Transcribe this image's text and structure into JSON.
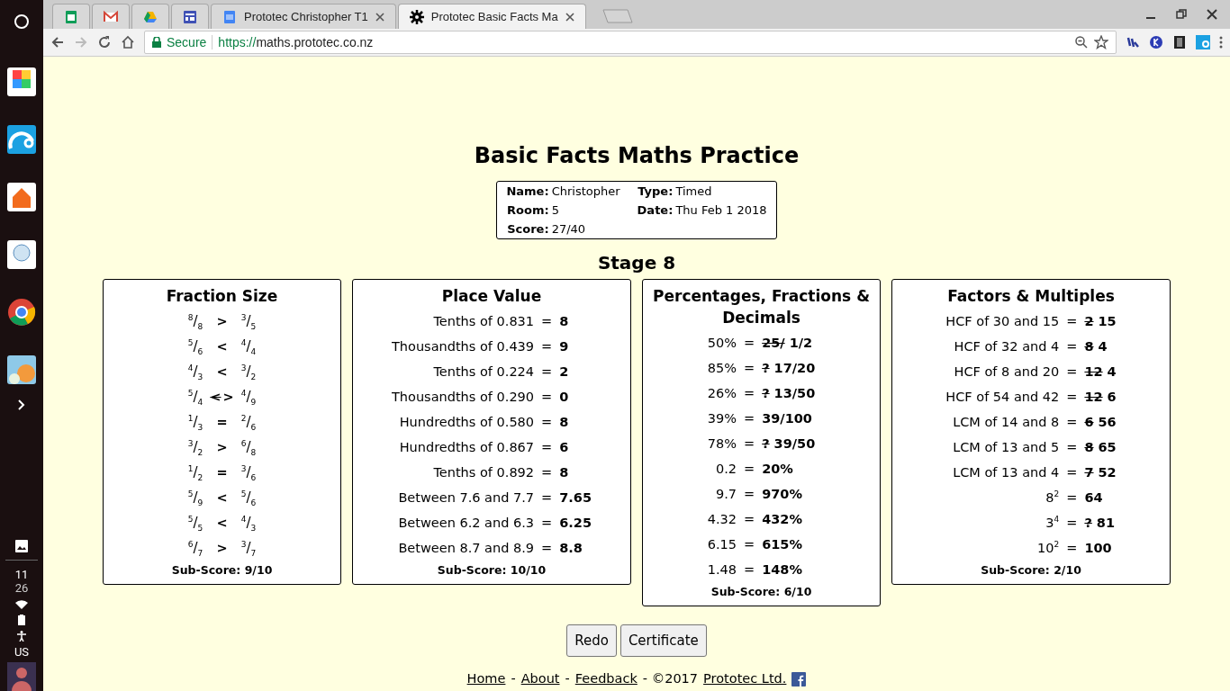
{
  "shelf": {
    "apps": [
      {
        "kind": "fotor"
      },
      {
        "kind": "wave"
      },
      {
        "kind": "go"
      },
      {
        "kind": "prezi"
      },
      {
        "kind": "chrome"
      },
      {
        "kind": "game"
      }
    ],
    "clock_hour": "11",
    "clock_minute": "26",
    "keyboard": "US"
  },
  "browser": {
    "tabs": [
      {
        "selected": false
      },
      {
        "selected": false
      },
      {
        "selected": false
      },
      {
        "selected": false
      },
      {
        "title": "Prototec Christopher T1",
        "selected": false
      },
      {
        "title": "Prototec Basic Facts Ma",
        "selected": true
      }
    ],
    "secure_label": "Secure",
    "url_scheme": "https://",
    "url_host": "maths.prototec.co.nz"
  },
  "page": {
    "title": "Basic Facts Maths Practice",
    "info": [
      {
        "label": "Name:",
        "value": "Christopher"
      },
      {
        "label": "Type:",
        "value": "Timed"
      },
      {
        "label": "Room:",
        "value": "5"
      },
      {
        "label": "Date:",
        "value": "Thu Feb 1 2018"
      },
      {
        "label": "Score:",
        "value": "27/40"
      }
    ],
    "stage": "Stage 8",
    "sections": [
      {
        "kind": "fractions",
        "title": "Fraction Size",
        "rows": [
          {
            "left": "$^{8}$/$_{8}$",
            "symbol": ">",
            "right": "$^{3}$/$_{5}$"
          },
          {
            "left": "$^{5}$/$_{6}$",
            "symbol": "<",
            "right": "$^{4}$/$_{4}$"
          },
          {
            "left": "$^{4}$/$_{3}$",
            "symbol": "<",
            "right": "$^{3}$/$_{2}$"
          },
          {
            "left": "$^{5}$/$_{4}$",
            "wrong": "<",
            "symbol": ">",
            "right": "$^{4}$/$_{9}$"
          },
          {
            "left": "$^{1}$/$_{3}$",
            "symbol": "=",
            "right": "$^{2}$/$_{6}$"
          },
          {
            "left": "$^{3}$/$_{2}$",
            "symbol": ">",
            "right": "$^{6}$/$_{8}$"
          },
          {
            "left": "$^{1}$/$_{2}$",
            "symbol": "=",
            "right": "$^{3}$/$_{6}$"
          },
          {
            "left": "$^{5}$/$_{9}$",
            "symbol": "<",
            "right": "$^{5}$/$_{6}$"
          },
          {
            "left": "$^{5}$/$_{5}$",
            "symbol": "<",
            "right": "$^{4}$/$_{3}$"
          },
          {
            "left": "$^{6}$/$_{7}$",
            "symbol": ">",
            "right": "$^{3}$/$_{7}$"
          }
        ],
        "subscore": "Sub-Score: 9/10"
      },
      {
        "kind": "equations",
        "title": "Place Value",
        "rows": [
          {
            "question": "Tenths of 0.831",
            "equals": "=",
            "answer": "8"
          },
          {
            "question": "Thousandths of 0.439",
            "equals": "=",
            "answer": "9"
          },
          {
            "question": "Tenths of 0.224",
            "equals": "=",
            "answer": "2"
          },
          {
            "question": "Thousandths of 0.290",
            "equals": "=",
            "answer": "0"
          },
          {
            "question": "Hundredths of 0.580",
            "equals": "=",
            "answer": "8"
          },
          {
            "question": "Hundredths of 0.867",
            "equals": "=",
            "answer": "6"
          },
          {
            "question": "Tenths of 0.892",
            "equals": "=",
            "answer": "8"
          },
          {
            "question": "Between 7.6 and 7.7",
            "equals": "=",
            "answer": "7.65"
          },
          {
            "question": "Between 6.2 and 6.3",
            "equals": "=",
            "answer": "6.25"
          },
          {
            "question": "Between 8.7 and 8.9",
            "equals": "=",
            "answer": "8.8"
          }
        ],
        "subscore": "Sub-Score: 10/10"
      },
      {
        "kind": "equations",
        "title": "Percentages, Fractions & Decimals",
        "rows": [
          {
            "question": "50%",
            "equals": "=",
            "wrong": "25/",
            "answer": "1/2"
          },
          {
            "question": "85%",
            "equals": "=",
            "wrong": "?",
            "answer": "17/20"
          },
          {
            "question": "26%",
            "equals": "=",
            "wrong": "?",
            "answer": "13/50"
          },
          {
            "question": "39%",
            "equals": "=",
            "answer": "39/100"
          },
          {
            "question": "78%",
            "equals": "=",
            "wrong": "?",
            "answer": "39/50"
          },
          {
            "question": "0.2",
            "equals": "=",
            "answer": "20%"
          },
          {
            "question": "9.7",
            "equals": "=",
            "answer": "970%"
          },
          {
            "question": "4.32",
            "equals": "=",
            "answer": "432%"
          },
          {
            "question": "6.15",
            "equals": "=",
            "answer": "615%"
          },
          {
            "question": "1.48",
            "equals": "=",
            "answer": "148%"
          }
        ],
        "subscore": "Sub-Score: 6/10"
      },
      {
        "kind": "equations",
        "title": "Factors & Multiples",
        "rows": [
          {
            "question": "HCF of 30 and 15",
            "equals": "=",
            "wrong": "2",
            "answer": "15"
          },
          {
            "question": "HCF of 32 and 4",
            "equals": "=",
            "wrong": "8",
            "answer": "4"
          },
          {
            "question": "HCF of 8 and 20",
            "equals": "=",
            "wrong": "12",
            "answer": "4"
          },
          {
            "question": "HCF of 54 and 42",
            "equals": "=",
            "wrong": "12",
            "answer": "6"
          },
          {
            "question": "LCM of 14 and 8",
            "equals": "=",
            "wrong": "6",
            "answer": "56"
          },
          {
            "question": "LCM of 13 and 5",
            "equals": "=",
            "wrong": "8",
            "answer": "65"
          },
          {
            "question": "LCM of 13 and 4",
            "equals": "=",
            "wrong": "7",
            "answer": "52"
          },
          {
            "question": "8$^{2}$",
            "equals": "=",
            "answer": "64"
          },
          {
            "question": "3$^{4}$",
            "equals": "=",
            "wrong": "?",
            "answer": "81"
          },
          {
            "question": "10$^{2}$",
            "equals": "=",
            "answer": "100"
          }
        ],
        "subscore": "Sub-Score: 2/10"
      }
    ],
    "buttons": [
      "Redo",
      "Certificate"
    ],
    "footer": [
      {
        "kind": "link",
        "text": "Home"
      },
      {
        "kind": "text",
        "text": "-"
      },
      {
        "kind": "link",
        "text": "About"
      },
      {
        "kind": "text",
        "text": "-"
      },
      {
        "kind": "link",
        "text": "Feedback"
      },
      {
        "kind": "text",
        "text": "- ©2017"
      },
      {
        "kind": "link",
        "text": "Prototec Ltd."
      },
      {
        "kind": "facebook"
      }
    ]
  }
}
